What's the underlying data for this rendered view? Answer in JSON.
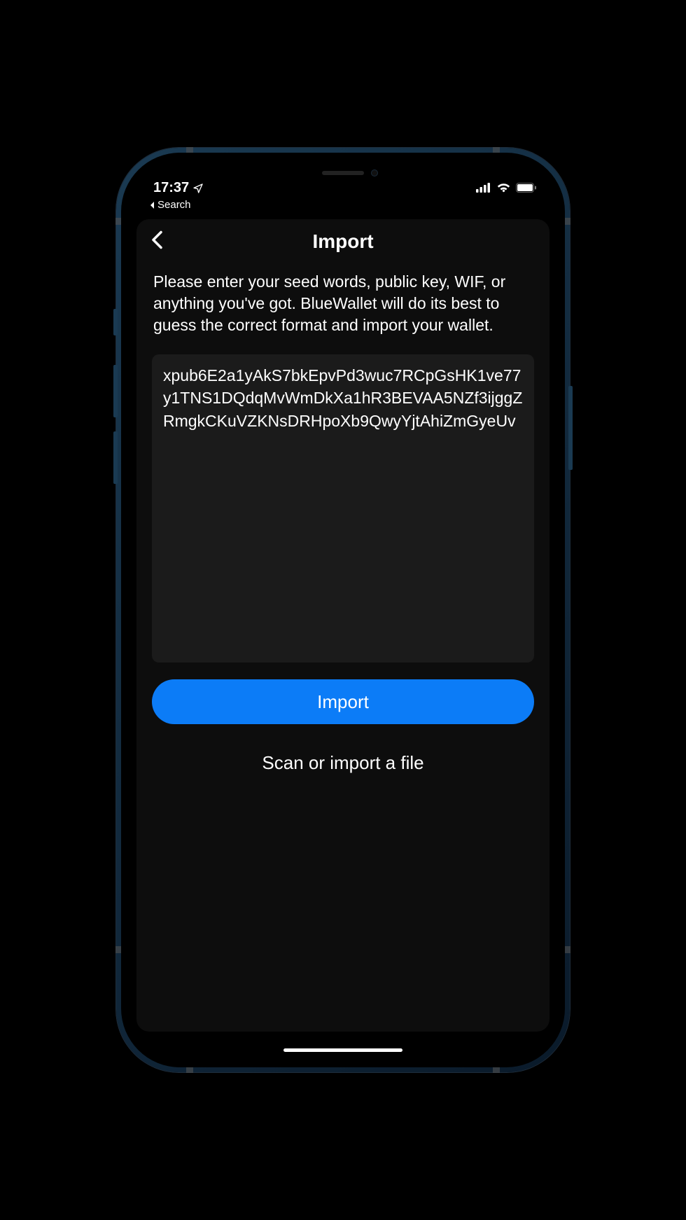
{
  "status": {
    "time": "17:37",
    "back_breadcrumb": "Search"
  },
  "screen": {
    "title": "Import",
    "instructions": "Please enter your seed words, public key, WIF, or anything you've got. BlueWallet will do its best to guess the correct format and import your wallet.",
    "input_value": "xpub6E2a1yAkS7bkEpvPd3wuc7RCpGsHK1ve77y1TNS1DQdqMvWmDkXa1hR3BEVAA5NZf3ijggZRmgkCKuVZKNsDRHpoXb9QwyYjtAhiZmGyeUv",
    "primary_button": "Import",
    "secondary_link": "Scan or import a file"
  },
  "colors": {
    "accent": "#0c7cf7",
    "card_bg": "#0d0d0d",
    "input_bg": "#1b1b1b"
  }
}
